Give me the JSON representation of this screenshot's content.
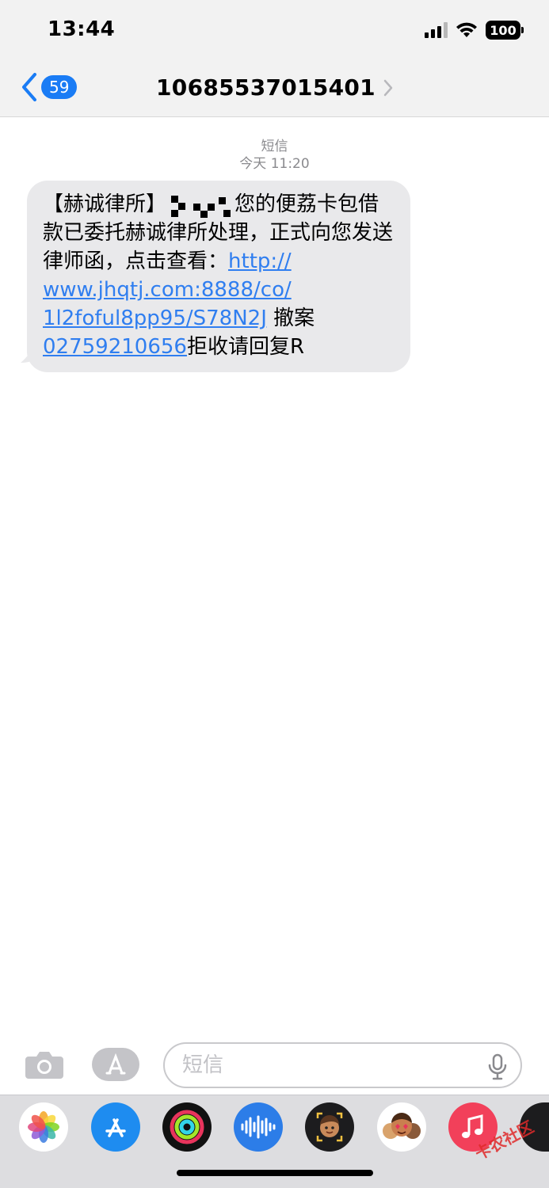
{
  "status_bar": {
    "time": "13:44",
    "battery": "100"
  },
  "nav": {
    "back_count": "59",
    "title": "10685537015401"
  },
  "conversation": {
    "service_label": "短信",
    "date": "今天 11:20",
    "message": {
      "part1": "【赫诚律所】",
      "part2": "您的便荔卡包借款已委托赫诚律所处理，正式向您发送律师函，点击查看：",
      "link_line1": "http://",
      "link_line2": "www.jhqtj.com:8888/co/",
      "link_line3": "1l2foful8pp95/S78N2J",
      "part3": " 撤案 ",
      "phone": "02759210656",
      "part4": "拒收请回复R"
    }
  },
  "composer": {
    "placeholder": "短信"
  },
  "app_drawer": {
    "apps": [
      "photos-icon",
      "app-store-icon",
      "activity-icon",
      "audio-message-icon",
      "memoji-icon",
      "animoji-stickers-icon",
      "music-icon",
      "more-app-icon"
    ]
  },
  "watermark": {
    "text": "卡农社区"
  },
  "colors": {
    "accent": "#1a7cf5",
    "link": "#2f7ef0",
    "bubble": "#e9e9eb",
    "drawer": "#dddde0"
  }
}
